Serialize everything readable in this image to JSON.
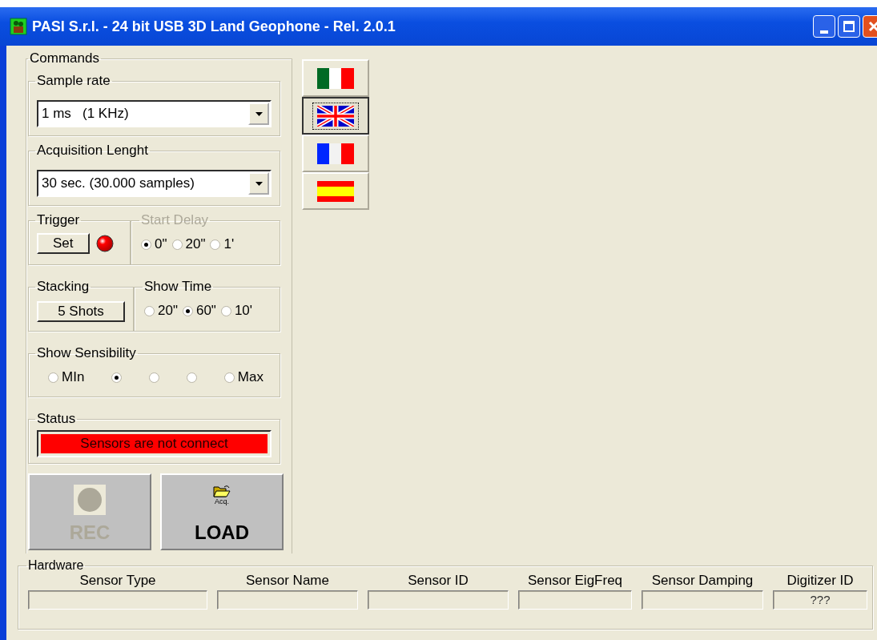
{
  "window": {
    "title": "PASI S.r.l. - 24 bit USB 3D Land Geophone - Rel. 2.0.1"
  },
  "commands": {
    "title": "Commands",
    "sample_rate": {
      "label": "Sample rate",
      "value": "1 ms   (1 KHz)"
    },
    "acquisition_length": {
      "label": "Acquisition Lenght",
      "value": "30 sec. (30.000 samples)"
    },
    "trigger": {
      "label": "Trigger",
      "button": "Set"
    },
    "start_delay": {
      "label": "Start Delay",
      "disabled": true,
      "options": [
        {
          "label": "0\"",
          "selected": true
        },
        {
          "label": "20\"",
          "selected": false
        },
        {
          "label": "1'",
          "selected": false
        }
      ]
    },
    "stacking": {
      "label": "Stacking",
      "button": "5 Shots"
    },
    "show_time": {
      "label": "Show Time",
      "options": [
        {
          "label": "20\"",
          "selected": false
        },
        {
          "label": "60\"",
          "selected": true
        },
        {
          "label": "10'",
          "selected": false
        }
      ]
    },
    "show_sensibility": {
      "label": "Show Sensibility",
      "options": [
        {
          "label": "MIn",
          "selected": false
        },
        {
          "selected": true
        },
        {
          "selected": false
        },
        {
          "selected": false
        },
        {
          "label": "Max",
          "selected": false
        }
      ]
    },
    "status": {
      "label": "Status",
      "text": "Sensors are not connect"
    },
    "rec": {
      "label": "REC",
      "disabled": true
    },
    "load": {
      "label": "LOAD",
      "icon_caption": "Acq.",
      "disabled": false
    }
  },
  "languages": [
    {
      "kind": "it",
      "selected": false
    },
    {
      "kind": "gb",
      "selected": true
    },
    {
      "kind": "fr",
      "selected": false
    },
    {
      "kind": "es",
      "selected": false
    }
  ],
  "hardware": {
    "title": "Hardware",
    "fields": [
      {
        "label": "Sensor Type"
      },
      {
        "label": "Sensor Name"
      },
      {
        "label": "Sensor ID"
      },
      {
        "label": "Sensor EigFreq"
      },
      {
        "label": "Sensor Damping"
      },
      {
        "label": "Digitizer ID",
        "value": "???"
      }
    ]
  }
}
